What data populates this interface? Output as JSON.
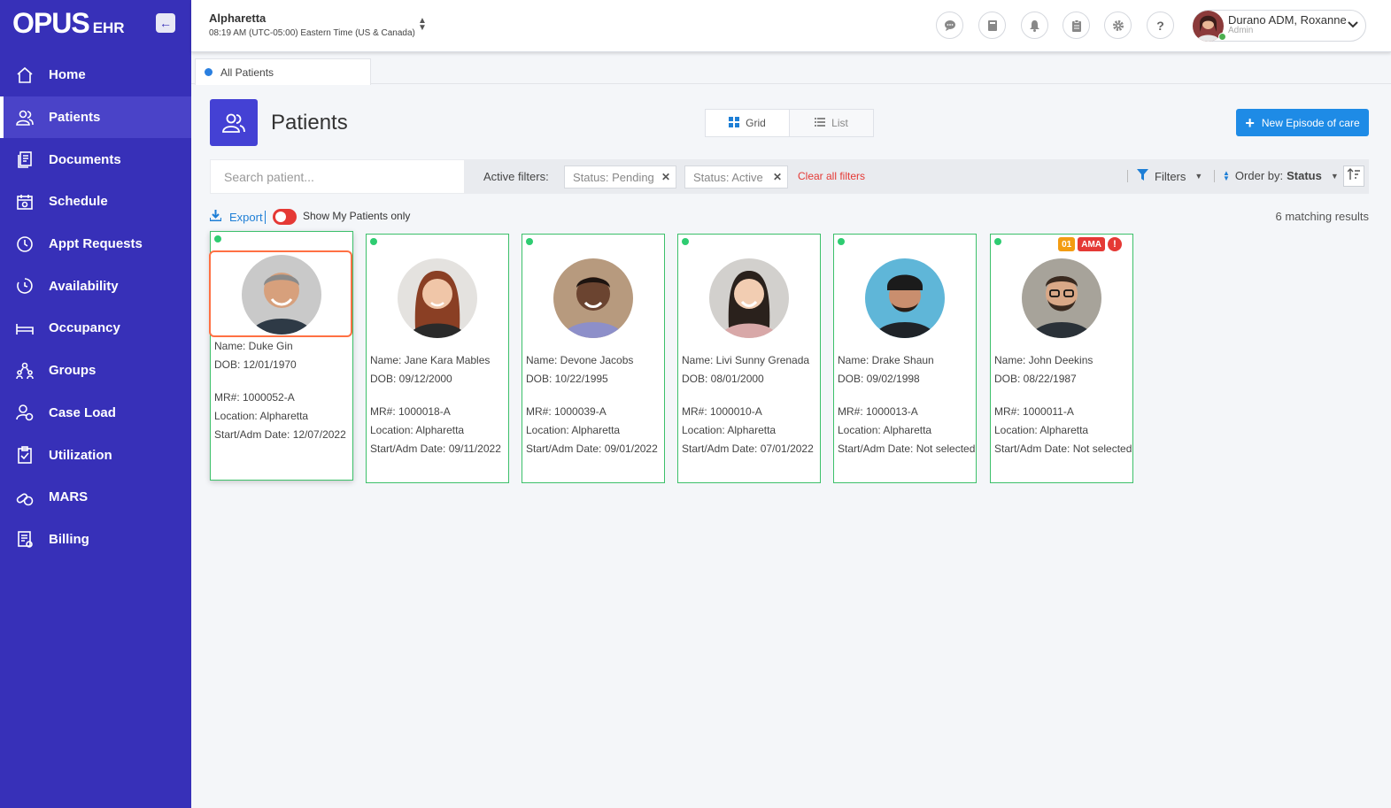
{
  "app": {
    "logo_main": "OPUS",
    "logo_sub": "EHR"
  },
  "sidebar": {
    "items": [
      {
        "label": "Home",
        "icon": "home-icon"
      },
      {
        "label": "Patients",
        "icon": "patients-icon",
        "active": true
      },
      {
        "label": "Documents",
        "icon": "documents-icon"
      },
      {
        "label": "Schedule",
        "icon": "calendar-icon"
      },
      {
        "label": "Appt Requests",
        "icon": "clock-icon"
      },
      {
        "label": "Availability",
        "icon": "availability-icon"
      },
      {
        "label": "Occupancy",
        "icon": "bed-icon"
      },
      {
        "label": "Groups",
        "icon": "groups-icon"
      },
      {
        "label": "Case Load",
        "icon": "case-load-icon"
      },
      {
        "label": "Utilization",
        "icon": "clipboard-icon"
      },
      {
        "label": "MARS",
        "icon": "pills-icon"
      },
      {
        "label": "Billing",
        "icon": "billing-icon"
      }
    ]
  },
  "header": {
    "location": "Alpharetta",
    "time": "08:19 AM (UTC-05:00) Eastern Time (US & Canada)",
    "icons": [
      "chat-icon",
      "book-icon",
      "bell-icon",
      "clipboard-icon",
      "gear-icon",
      "help-icon"
    ],
    "user": {
      "name": "Durano ADM, Roxanne",
      "role": "Admin"
    }
  },
  "tabs": [
    {
      "label": "All Patients"
    }
  ],
  "page": {
    "title": "Patients",
    "view_grid": "Grid",
    "view_list": "List",
    "new_episode": "New Episode of care"
  },
  "filters": {
    "search_placeholder": "Search patient...",
    "active_label": "Active filters:",
    "chips": [
      "Status: Pending",
      "Status: Active"
    ],
    "clear_all": "Clear all filters",
    "filters_label": "Filters",
    "order_prefix": "Order by:",
    "order_value": "Status"
  },
  "toolbar": {
    "export": "Export",
    "my_patients": "Show My Patients only",
    "results": "6 matching results"
  },
  "patients": [
    {
      "name": "Name: Duke Gin",
      "dob": "DOB: 12/01/1970",
      "mr": "MR#: 1000052-A",
      "location": "Location: Alpharetta",
      "start": "Start/Adm Date: 12/07/2022"
    },
    {
      "name": "Name: Jane Kara Mables",
      "dob": "DOB: 09/12/2000",
      "mr": "MR#: 1000018-A",
      "location": "Location: Alpharetta",
      "start": "Start/Adm Date: 09/11/2022"
    },
    {
      "name": "Name: Devone Jacobs",
      "dob": "DOB: 10/22/1995",
      "mr": "MR#: 1000039-A",
      "location": "Location: Alpharetta",
      "start": "Start/Adm Date: 09/01/2022"
    },
    {
      "name": "Name: Livi Sunny Grenada",
      "dob": "DOB: 08/01/2000",
      "mr": "MR#: 1000010-A",
      "location": "Location: Alpharetta",
      "start": "Start/Adm Date: 07/01/2022"
    },
    {
      "name": "Name: Drake Shaun",
      "dob": "DOB: 09/02/1998",
      "mr": "MR#: 1000013-A",
      "location": "Location: Alpharetta",
      "start": "Start/Adm Date: Not selected"
    },
    {
      "name": "Name: John Deekins",
      "dob": "DOB: 08/22/1987",
      "mr": "MR#: 1000011-A",
      "location": "Location: Alpharetta",
      "start": "Start/Adm Date: Not selected",
      "badges": [
        "01",
        "AMA",
        "!"
      ]
    }
  ],
  "colors": {
    "sidebar": "#3730b8",
    "accent": "#1e8be6",
    "card_border": "#3cc06a",
    "danger": "#e53935",
    "badge_orange": "#f39c12"
  }
}
